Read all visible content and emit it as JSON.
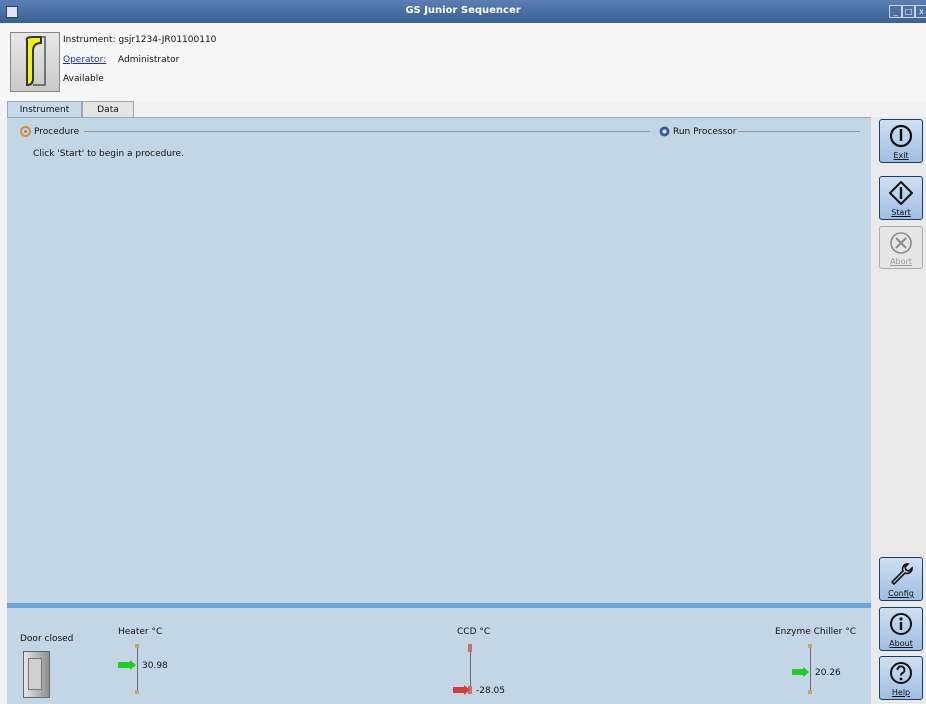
{
  "window": {
    "title": "GS Junior Sequencer",
    "controls": [
      "_",
      "□",
      "x"
    ]
  },
  "header": {
    "instrument_label": "Instrument:",
    "instrument_value": "gsjr1234-JR01100110",
    "operator_label": "Operator:",
    "operator_value": "Administrator",
    "status": "Available"
  },
  "tabs": [
    {
      "label": "Instrument"
    },
    {
      "label": "Data"
    }
  ],
  "main": {
    "procedure_title": "Procedure",
    "procedure_message": "Click 'Start' to begin a procedure.",
    "run_processor_title": "Run Processor"
  },
  "toolbar": {
    "exit": "Exit",
    "start": "Start",
    "abort": "Abort",
    "config": "Config",
    "about": "About",
    "help": "Help"
  },
  "status": {
    "door": "Door closed",
    "heater": {
      "label": "Heater °C",
      "value": "30.98"
    },
    "ccd": {
      "label": "CCD °C",
      "value": "-28.05"
    },
    "chiller": {
      "label": "Enzyme Chiller °C",
      "value": "20.26"
    }
  },
  "colors": {
    "accent": "#68a6dc",
    "panel": "#c3d6e6",
    "ok": "#22cc22",
    "warn": "#d83a3a"
  }
}
